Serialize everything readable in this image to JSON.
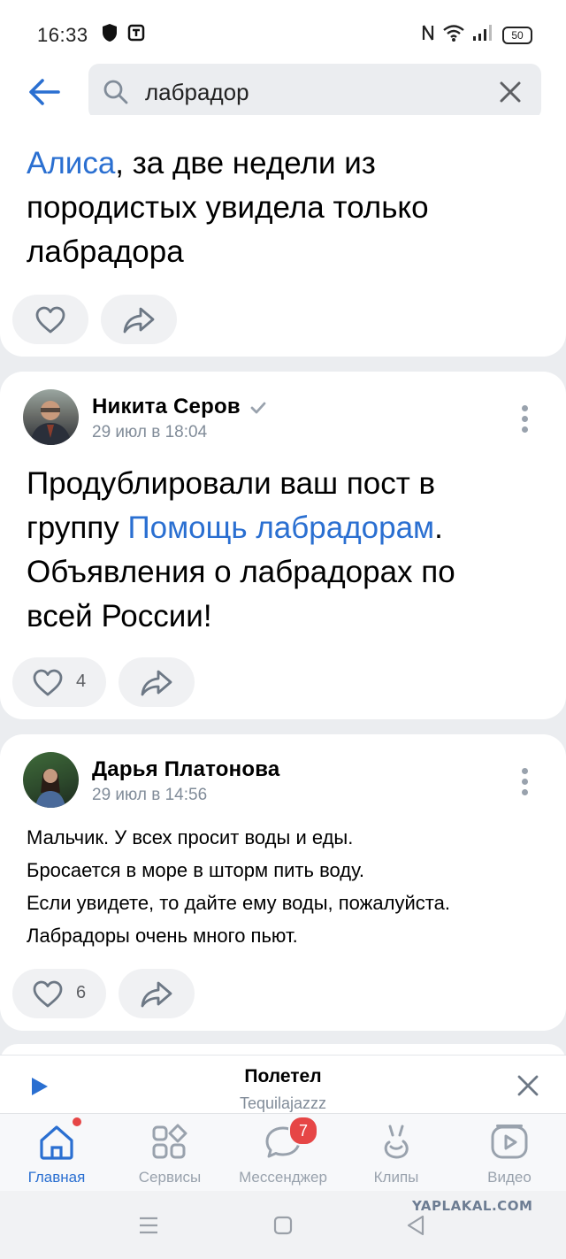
{
  "status_bar": {
    "time": "16:33",
    "battery": "50"
  },
  "search": {
    "query": "лабрадор"
  },
  "posts": [
    {
      "text_link": "Алиса",
      "text_rest": ", за две недели из породистых увидела только лабрадора",
      "likes": ""
    },
    {
      "author": "Никита Серов",
      "date": "29 июл в 18:04",
      "text_before": "Продублировали ваш пост в группу ",
      "text_link": "Помощь лабрадорам",
      "text_after": ". Объявления о лабрадорах по всей России!",
      "likes": "4"
    },
    {
      "author": "Дарья Платонова",
      "date": "29 июл в 14:56",
      "lines": [
        "Мальчик. У всех просит воды и еды.",
        "Бросается в море в шторм пить воду.",
        "Если увидете, то дайте ему воды, пожалуйста.",
        "Лабрадоры очень много пьют."
      ],
      "likes": "6"
    }
  ],
  "player": {
    "title": "Полетел",
    "artist": "Tequilajazzz"
  },
  "tabs": [
    {
      "label": "Главная",
      "icon": "home-icon",
      "active": true
    },
    {
      "label": "Сервисы",
      "icon": "services-icon"
    },
    {
      "label": "Мессенджер",
      "icon": "messenger-icon",
      "badge": "7"
    },
    {
      "label": "Клипы",
      "icon": "clips-icon"
    },
    {
      "label": "Видео",
      "icon": "video-icon"
    }
  ],
  "watermark": "YAPLAKAL.COM",
  "colors": {
    "accent": "#2a6fd1",
    "badge": "#e64646",
    "secondary_text": "#818c99"
  }
}
